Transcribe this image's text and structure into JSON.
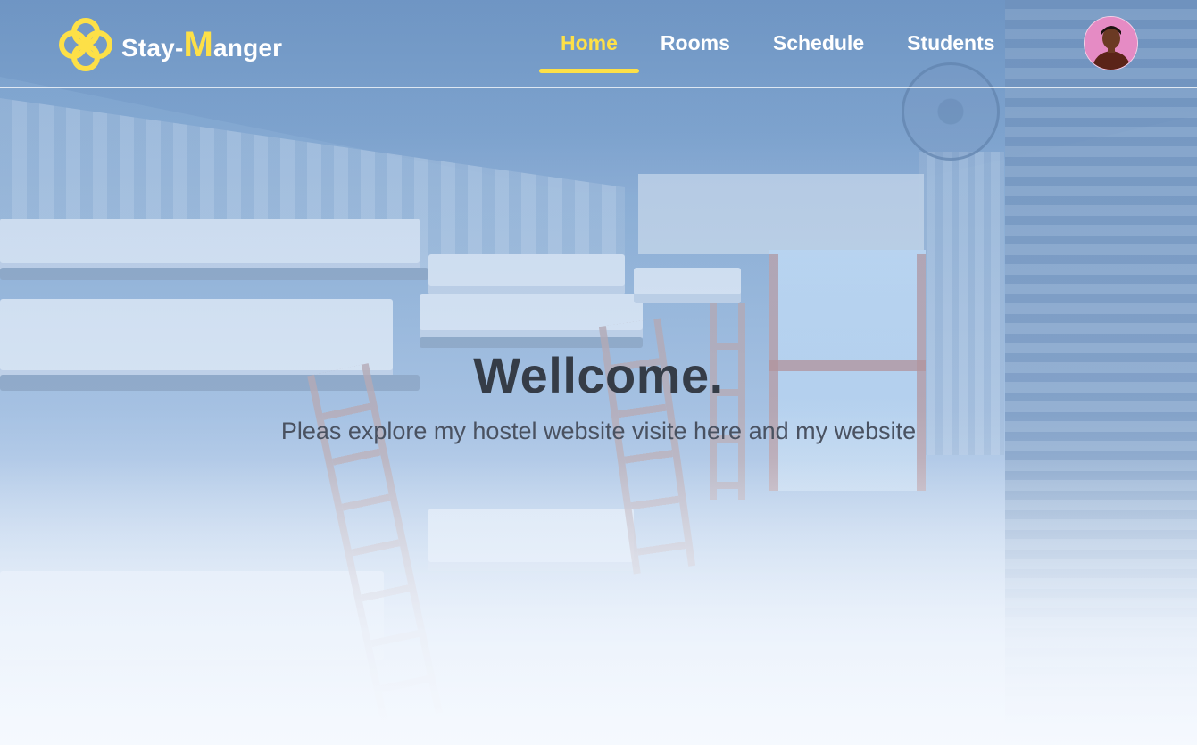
{
  "header": {
    "brand_prefix": "Stay-",
    "brand_initial": "M",
    "brand_suffix": "anger",
    "nav": [
      {
        "label": "Home",
        "active": true
      },
      {
        "label": "Rooms",
        "active": false
      },
      {
        "label": "Schedule",
        "active": false
      },
      {
        "label": "Students",
        "active": false
      }
    ]
  },
  "hero": {
    "title": "Wellcome.",
    "subtitle": "Pleas explore my hostel website visite here and my website"
  },
  "icons": {
    "logo": "four-petal-flower-logo-icon",
    "avatar": "user-avatar"
  },
  "colors": {
    "accent": "#fde047",
    "title": "#353c47",
    "subtitle": "#4a5261",
    "avatar_bg": "#e58bc4"
  }
}
